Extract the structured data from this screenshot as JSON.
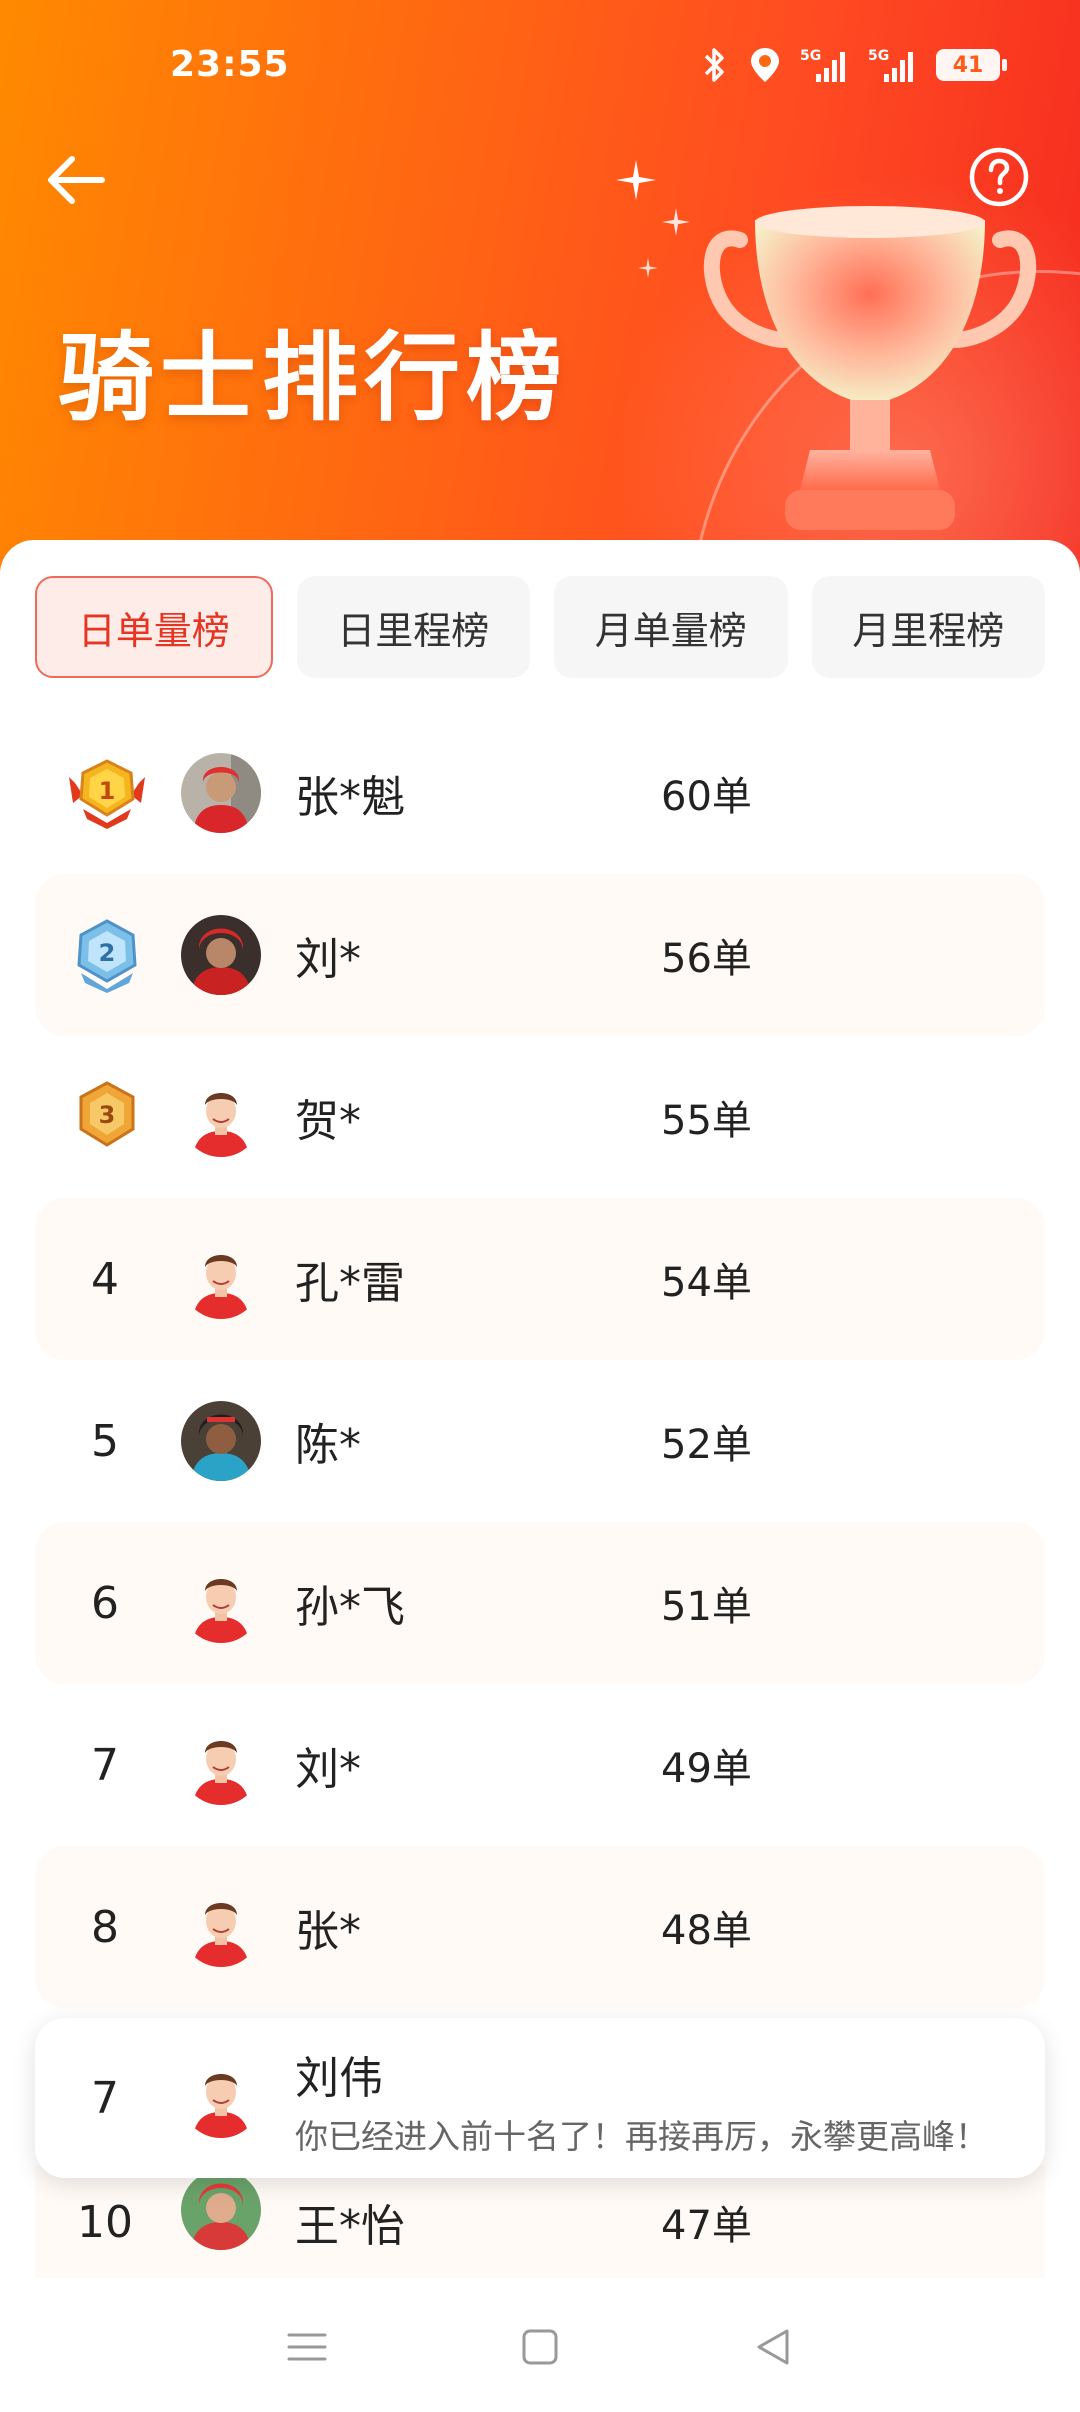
{
  "status_bar": {
    "time": "23:55",
    "battery": "41",
    "icons": [
      "bluetooth-icon",
      "location-icon",
      "signal-5g-icon",
      "signal-5g-icon",
      "battery-icon"
    ]
  },
  "header": {
    "title": "骑士排行榜",
    "back_icon": "arrow-left-icon",
    "help_icon": "question-circle-icon"
  },
  "tabs": [
    {
      "label": "日单量榜",
      "active": true
    },
    {
      "label": "日里程榜",
      "active": false
    },
    {
      "label": "月单量榜",
      "active": false
    },
    {
      "label": "月里程榜",
      "active": false
    }
  ],
  "leaderboard": [
    {
      "rank": "1",
      "name": "张*魁",
      "count": "60单",
      "medal": "gold"
    },
    {
      "rank": "2",
      "name": "刘*",
      "count": "56单",
      "medal": "silver"
    },
    {
      "rank": "3",
      "name": "贺*",
      "count": "55单",
      "medal": "bronze"
    },
    {
      "rank": "4",
      "name": "孔*雷",
      "count": "54单"
    },
    {
      "rank": "5",
      "name": "陈*",
      "count": "52单"
    },
    {
      "rank": "6",
      "name": "孙*飞",
      "count": "51单"
    },
    {
      "rank": "7",
      "name": "刘*",
      "count": "49单"
    },
    {
      "rank": "8",
      "name": "张*",
      "count": "48单"
    }
  ],
  "my_rank": {
    "rank": "7",
    "name": "刘伟",
    "message": "你已经进入前十名了！再接再厉，永攀更高峰！"
  },
  "partial_row": {
    "rank": "10",
    "name": "王*怡",
    "count": "47单"
  },
  "colors": {
    "accent": "#e73523",
    "header_start": "#ff8a00",
    "header_end": "#f52a1f"
  }
}
